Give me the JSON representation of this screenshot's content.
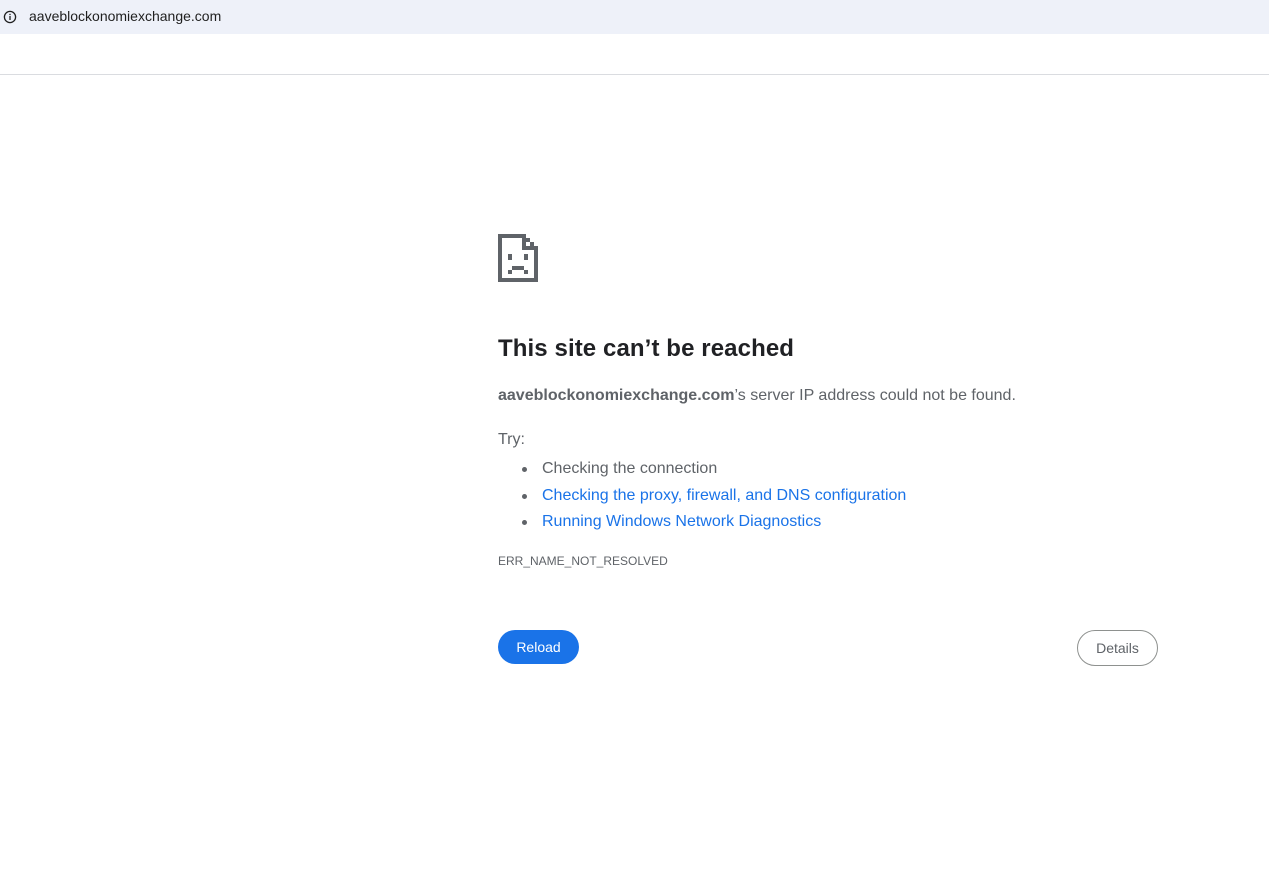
{
  "address_bar": {
    "url": "aaveblockonomiexchange.com",
    "icon": "info-icon"
  },
  "error_page": {
    "icon": "sad-page-icon",
    "headline": "This site can’t be reached",
    "summary_host": "aaveblockonomiexchange.com",
    "summary_rest": "’s server IP address could not be found.",
    "try_label": "Try:",
    "suggestions": [
      {
        "text": "Checking the connection",
        "link": false
      },
      {
        "text": "Checking the proxy, firewall, and DNS configuration",
        "link": true
      },
      {
        "text": "Running Windows Network Diagnostics",
        "link": true
      }
    ],
    "error_code": "ERR_NAME_NOT_RESOLVED",
    "reload_label": "Reload",
    "details_label": "Details"
  },
  "colors": {
    "accent": "#1a73e8",
    "text_secondary": "#5f6368",
    "address_bar_bg": "#eef1f9"
  }
}
